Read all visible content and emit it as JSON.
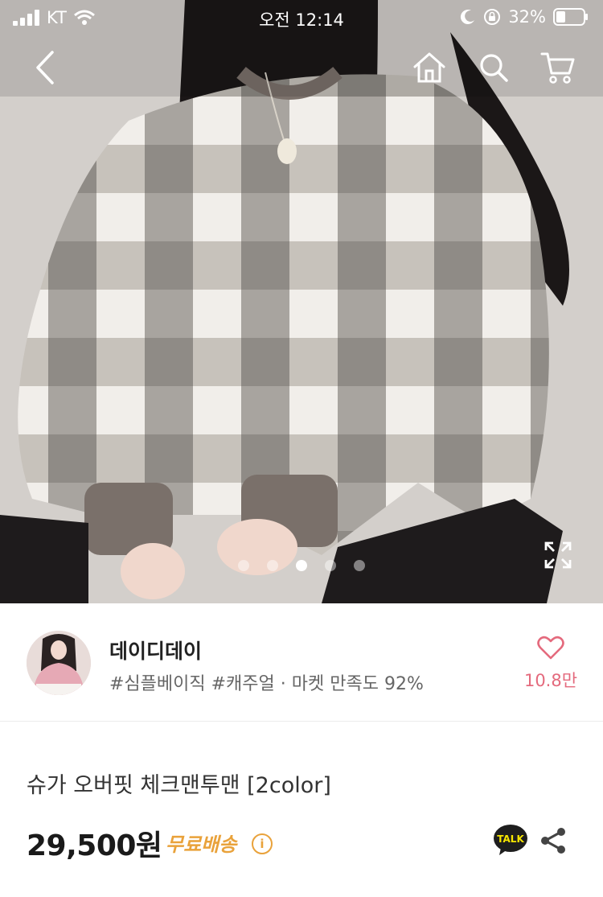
{
  "status_bar": {
    "carrier": "KT",
    "time": "오전 12:14",
    "battery": "32%"
  },
  "gallery": {
    "total_images": 5,
    "active_index": 2
  },
  "shop": {
    "name": "데이디데이",
    "tags": "#심플베이직 #캐주얼 · 마켓 만족도 92%",
    "likes": "10.8만"
  },
  "product": {
    "name": "슈가 오버핏 체크맨투맨 [2color]",
    "price": "29,500원",
    "shipping": "무료배송",
    "info_symbol": "i",
    "talk_label": "TALK"
  },
  "colors": {
    "like": "#e46a7d",
    "shipping": "#e9a23b"
  }
}
